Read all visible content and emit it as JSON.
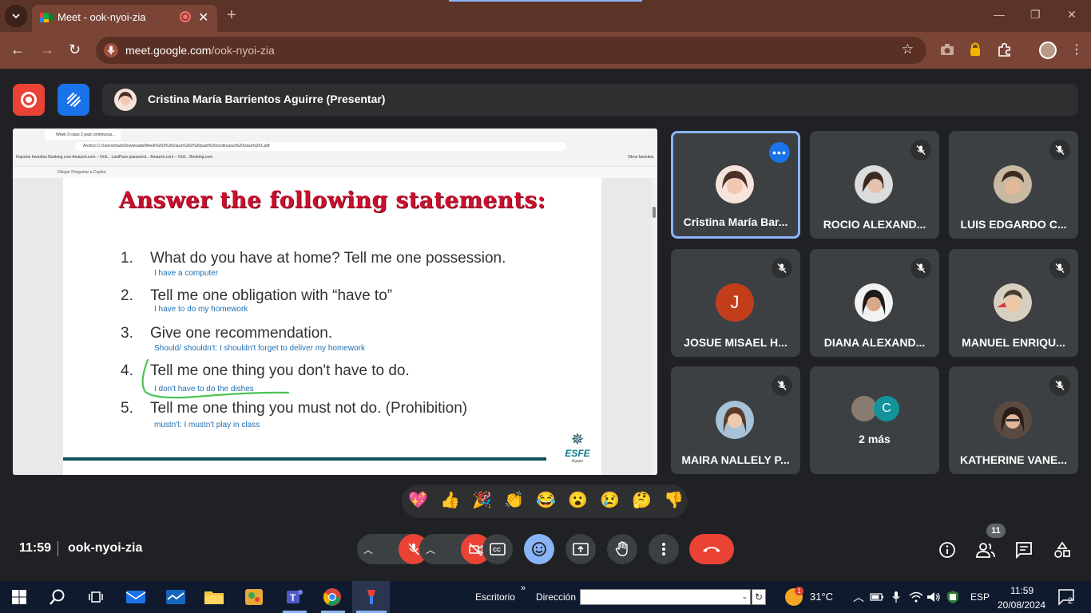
{
  "browser": {
    "tab_title": "Meet - ook-nyoi-zia",
    "tab_close": "✕",
    "new_tab": "+",
    "url_host": "meet.google.com",
    "url_path": "/ook-nyoi-zia",
    "back": "←",
    "forward": "→",
    "reload": "↻",
    "bookmark_star": "☆",
    "menu": "⋮",
    "window_min": "—",
    "window_max": "❐",
    "window_close": "✕"
  },
  "meet": {
    "presenter_label": "Cristina María Barrientos Aguirre (Presentar)",
    "meeting_time": "11:59",
    "meeting_code": "ook-nyoi-zia",
    "participant_count": "11",
    "colors": {
      "accent": "#8ab4f8",
      "danger": "#ea4335",
      "tile": "#3c4043",
      "background": "#202124"
    }
  },
  "shared_screen": {
    "mini_tab": "Week 3 class 2 past continuous...",
    "mini_url": "Archivo   C:/Users/mark/Downloads/Week%203%20class%202%20past%20continuous%20class%201.pdf",
    "mini_bookmarks": "Importar favoritos   Booking.com   Amazon.com – Onli...   LastPass password...   Amazon.com – Onli...   Booking.com",
    "mini_other_favs": "Otros favoritos",
    "mini_pdf_tools": "Dibujar   Preguntar a Copilot",
    "slide_title": "Answer the following statements:",
    "questions": [
      {
        "num": "1.",
        "text": "What do you have at home? Tell me one possession.",
        "answer": "I have a computer"
      },
      {
        "num": "2.",
        "text": "Tell me one obligation with “have to”",
        "answer": "I have to do my homework"
      },
      {
        "num": "3.",
        "text": "Give one recommendation.",
        "answer": "Should/ shouldn't: I shouldn't forget to deliver my homework"
      },
      {
        "num": "4.",
        "text": "Tell me one thing you don't have to do.",
        "answer": "I don't have to do the dishes"
      },
      {
        "num": "5.",
        "text": "Tell me one thing you must not do. (Prohibition)",
        "answer": "mustn't: I mustn't play in class"
      }
    ],
    "logo_text": "ESFE",
    "logo_sub": "Agape"
  },
  "participants": [
    {
      "name": "Cristina María Bar...",
      "status": "more-options"
    },
    {
      "name": "ROCIO ALEXAND...",
      "status": "muted"
    },
    {
      "name": "LUIS EDGARDO C...",
      "status": "muted"
    },
    {
      "name": "JOSUE MISAEL H...",
      "status": "muted",
      "initial": "J"
    },
    {
      "name": "DIANA ALEXAND...",
      "status": "muted"
    },
    {
      "name": "MANUEL ENRIQU...",
      "status": "muted"
    },
    {
      "name": "MAIRA NALLELY P...",
      "status": "muted"
    },
    {
      "name": "2 más",
      "initial": "C"
    },
    {
      "name": "KATHERINE VANE...",
      "status": "muted"
    }
  ],
  "reactions": [
    "💖",
    "👍",
    "🎉",
    "👏",
    "😂",
    "😮",
    "😢",
    "🤔",
    "👎"
  ],
  "taskbar": {
    "escritorio": "Escritorio",
    "direccion": "Dirección",
    "chevron": "»",
    "temperature": "31°C",
    "weather_badge": "1",
    "language": "ESP",
    "time": "11:59",
    "date": "20/08/2024",
    "notifications": "2"
  }
}
